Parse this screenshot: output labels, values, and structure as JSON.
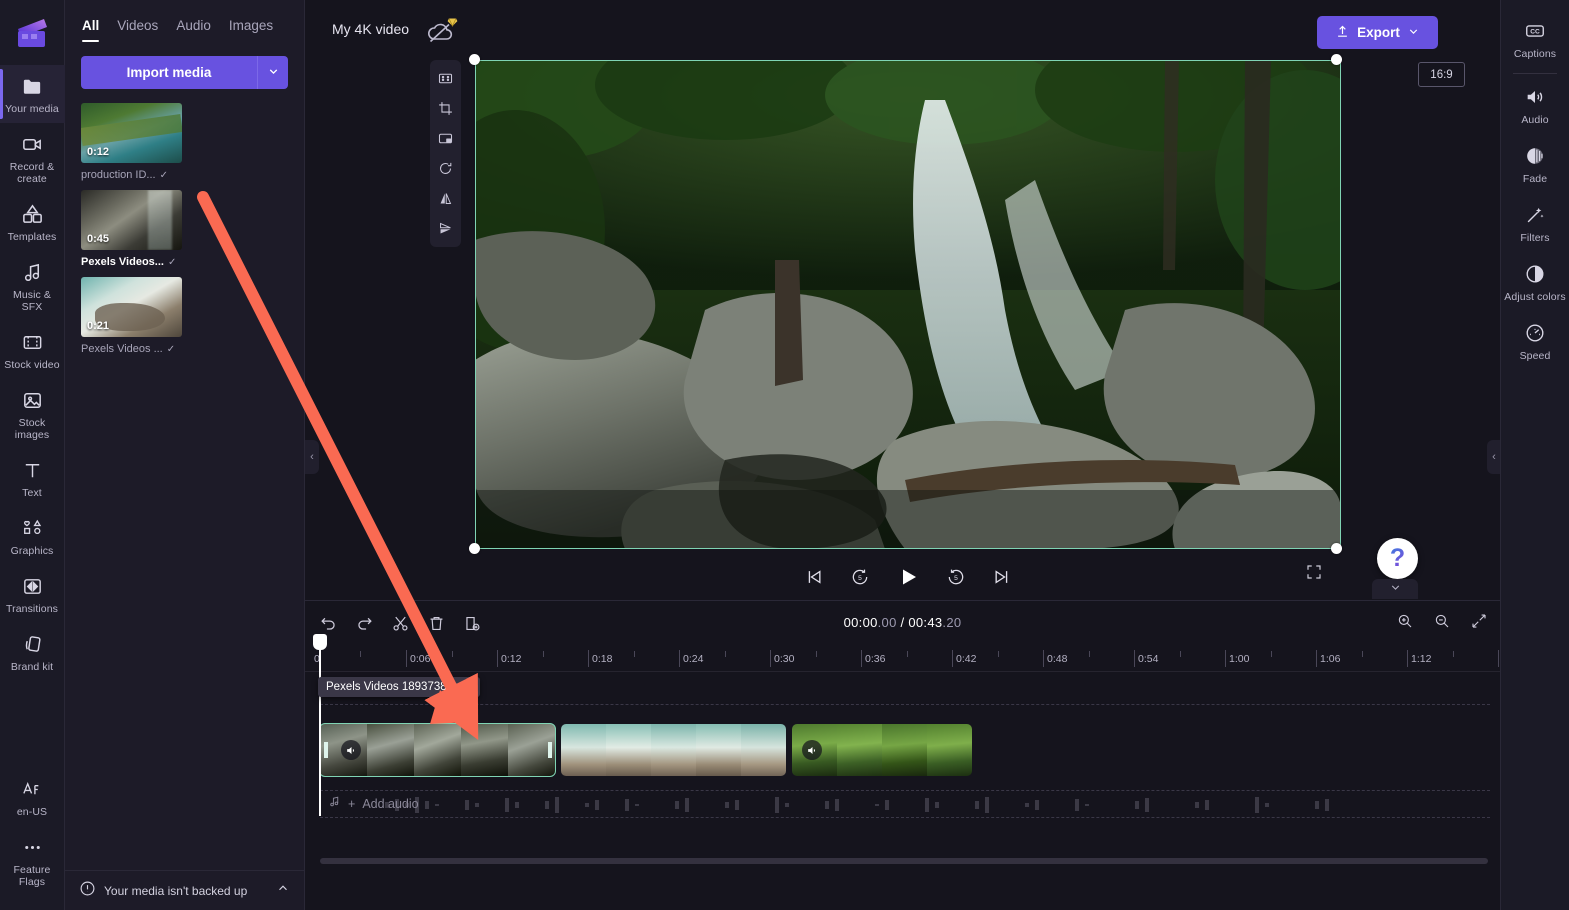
{
  "app": {
    "name": "Clipchamp"
  },
  "left_rail": {
    "logo_name": "clipchamp-logo",
    "items": [
      {
        "label": "Your media",
        "icon": "folder-icon",
        "active": true
      },
      {
        "label": "Record & create",
        "icon": "video-camera-icon",
        "active": false
      },
      {
        "label": "Templates",
        "icon": "templates-grid-icon",
        "active": false
      },
      {
        "label": "Music & SFX",
        "icon": "music-note-icon",
        "active": false
      },
      {
        "label": "Stock video",
        "icon": "film-strip-icon",
        "active": false
      },
      {
        "label": "Stock images",
        "icon": "image-icon",
        "active": false
      },
      {
        "label": "Text",
        "icon": "text-t-icon",
        "active": false
      },
      {
        "label": "Graphics",
        "icon": "shapes-icon",
        "active": false
      },
      {
        "label": "Transitions",
        "icon": "transitions-icon",
        "active": false
      },
      {
        "label": "Brand kit",
        "icon": "brand-kit-icon",
        "active": false
      }
    ],
    "bottom_items": [
      {
        "label": "en-US",
        "icon": "language-icon"
      },
      {
        "label": "Feature Flags",
        "icon": "ellipsis-icon"
      }
    ]
  },
  "media_panel": {
    "tabs": [
      {
        "label": "All",
        "active": true
      },
      {
        "label": "Videos",
        "active": false
      },
      {
        "label": "Audio",
        "active": false
      },
      {
        "label": "Images",
        "active": false
      }
    ],
    "import": {
      "label": "Import media",
      "caret_icon": "chevron-down-icon"
    },
    "items": [
      {
        "name": "production ID...",
        "duration": "0:12",
        "selected": false,
        "check_icon": "check-icon"
      },
      {
        "name": "Pexels Videos...",
        "duration": "0:45",
        "selected": true,
        "check_icon": "check-icon"
      },
      {
        "name": "Pexels Videos ...",
        "duration": "0:21",
        "selected": false,
        "check_icon": "check-icon"
      }
    ],
    "backup_notice": {
      "text": "Your media isn't backed up",
      "icon": "warning-circle-icon",
      "chevron": "chevron-up-icon"
    }
  },
  "header": {
    "project_title": "My 4K video",
    "cloud_icon": "cloud-off-icon",
    "premium_badge_icon": "diamond-icon",
    "export": {
      "label": "Export",
      "upload_icon": "upload-icon",
      "caret_icon": "chevron-down-icon"
    },
    "aspect_ratio": "16:9"
  },
  "preview_tools": [
    {
      "name": "fit-to-frame-icon"
    },
    {
      "name": "crop-icon"
    },
    {
      "name": "picture-in-picture-icon"
    },
    {
      "name": "rotate-icon"
    },
    {
      "name": "flip-horizontal-icon"
    },
    {
      "name": "flip-vertical-icon"
    }
  ],
  "playback": {
    "controls": [
      {
        "name": "skip-to-start-button"
      },
      {
        "name": "rewind-5-seconds-button",
        "label": "5"
      },
      {
        "name": "play-button"
      },
      {
        "name": "forward-5-seconds-button",
        "label": "5"
      },
      {
        "name": "skip-to-end-button"
      }
    ],
    "fullscreen_icon": "fullscreen-icon"
  },
  "help": {
    "icon": "question-mark-icon",
    "chevron": "chevron-down-icon"
  },
  "right_rail": {
    "items": [
      {
        "label": "Captions",
        "icon": "closed-captions-icon"
      },
      {
        "label": "Audio",
        "icon": "speaker-icon"
      },
      {
        "label": "Fade",
        "icon": "fade-icon"
      },
      {
        "label": "Filters",
        "icon": "magic-wand-icon"
      },
      {
        "label": "Adjust colors",
        "icon": "contrast-icon"
      },
      {
        "label": "Speed",
        "icon": "speedometer-icon"
      }
    ]
  },
  "timeline": {
    "tools": [
      {
        "name": "undo-button",
        "icon": "undo-icon"
      },
      {
        "name": "redo-button",
        "icon": "redo-icon"
      },
      {
        "name": "split-button",
        "icon": "scissors-icon"
      },
      {
        "name": "delete-button",
        "icon": "trash-icon"
      },
      {
        "name": "duplicate-button",
        "icon": "duplicate-icon"
      }
    ],
    "timecode": {
      "current": "00:00",
      "current_frames": ".00",
      "separator": " / ",
      "total": "00:43",
      "total_frames": ".20"
    },
    "zoom_tools": [
      {
        "name": "zoom-in-button",
        "icon": "zoom-in-icon"
      },
      {
        "name": "zoom-out-button",
        "icon": "zoom-out-icon"
      },
      {
        "name": "fit-timeline-button",
        "icon": "fit-timeline-icon"
      }
    ],
    "ruler_labels": [
      "0",
      "0:06",
      "0:12",
      "0:18",
      "0:24",
      "0:30",
      "0:36",
      "0:42",
      "0:48",
      "0:54",
      "1:00",
      "1:06",
      "1:12"
    ],
    "playhead_time": "0",
    "clip_tooltip": "Pexels Videos 1893738.mp4",
    "clips": [
      {
        "name": "clip-1",
        "selected": true,
        "has_audio_icon": true,
        "trim_handles": true
      },
      {
        "name": "clip-2",
        "selected": false,
        "has_audio_icon": false,
        "trim_handles": false
      },
      {
        "name": "clip-3",
        "selected": false,
        "has_audio_icon": true,
        "trim_handles": false
      }
    ],
    "audio_track": {
      "label": "Add audio",
      "music_icon": "music-note-icon",
      "plus_icon": "plus-icon"
    }
  },
  "colors": {
    "accent": "#6852e0",
    "selection": "#7fd4b4",
    "annotation_arrow": "#fa6a52",
    "panel_bg": "#1d1b28",
    "rail_bg": "#1b1a26",
    "stage_bg": "#15141d"
  }
}
